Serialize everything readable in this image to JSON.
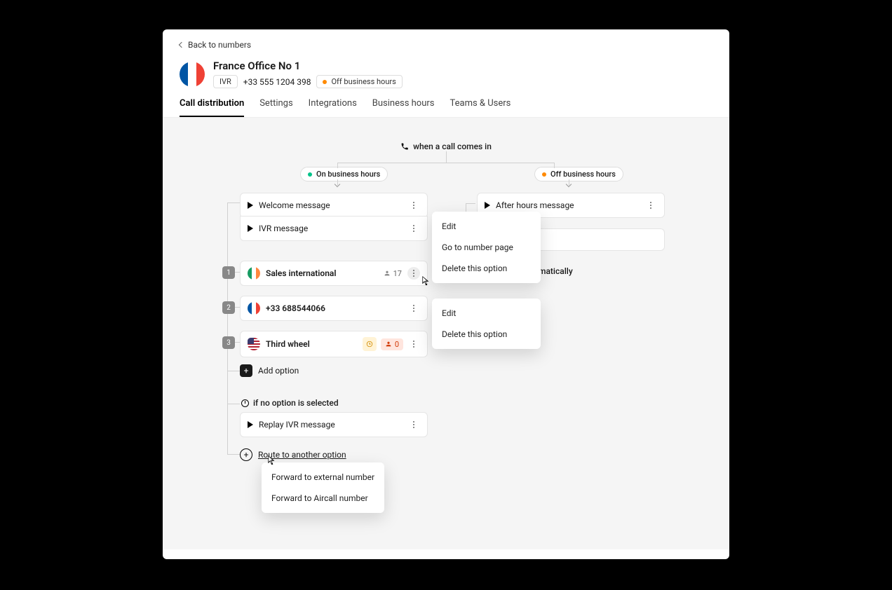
{
  "back_label": "Back to numbers",
  "header": {
    "title": "France Office No 1",
    "ivr_badge": "IVR",
    "phone": "+33 555 1204 398",
    "status_label": "Off business hours"
  },
  "tabs": [
    "Call distribution",
    "Settings",
    "Integrations",
    "Business hours",
    "Teams & Users"
  ],
  "active_tab": 0,
  "flow": {
    "root_label": "when a call comes in",
    "on_hours_label": "On business hours",
    "off_hours_label": "Off business hours",
    "cards": {
      "welcome": "Welcome message",
      "ivr": "IVR message",
      "after_hours": "After hours message"
    },
    "options": [
      {
        "num": "1",
        "label": "Sales international",
        "flag": "ie",
        "users": "17"
      },
      {
        "num": "2",
        "label": "+33 688544066",
        "flag": "fr"
      },
      {
        "num": "3",
        "label": "Third wheel",
        "flag": "us",
        "warn": true,
        "users_red": "0"
      }
    ],
    "add_option_label": "Add option",
    "no_option_label": "if no option is selected",
    "replay_label": "Replay IVR message",
    "route_another_label": "Route to another option",
    "end_call_partial": "matically"
  },
  "menu1": [
    "Edit",
    "Go to number page",
    "Delete this option"
  ],
  "menu2": [
    "Edit",
    "Delete this option"
  ],
  "menu3": [
    "Forward to external number",
    "Forward to Aircall number"
  ]
}
